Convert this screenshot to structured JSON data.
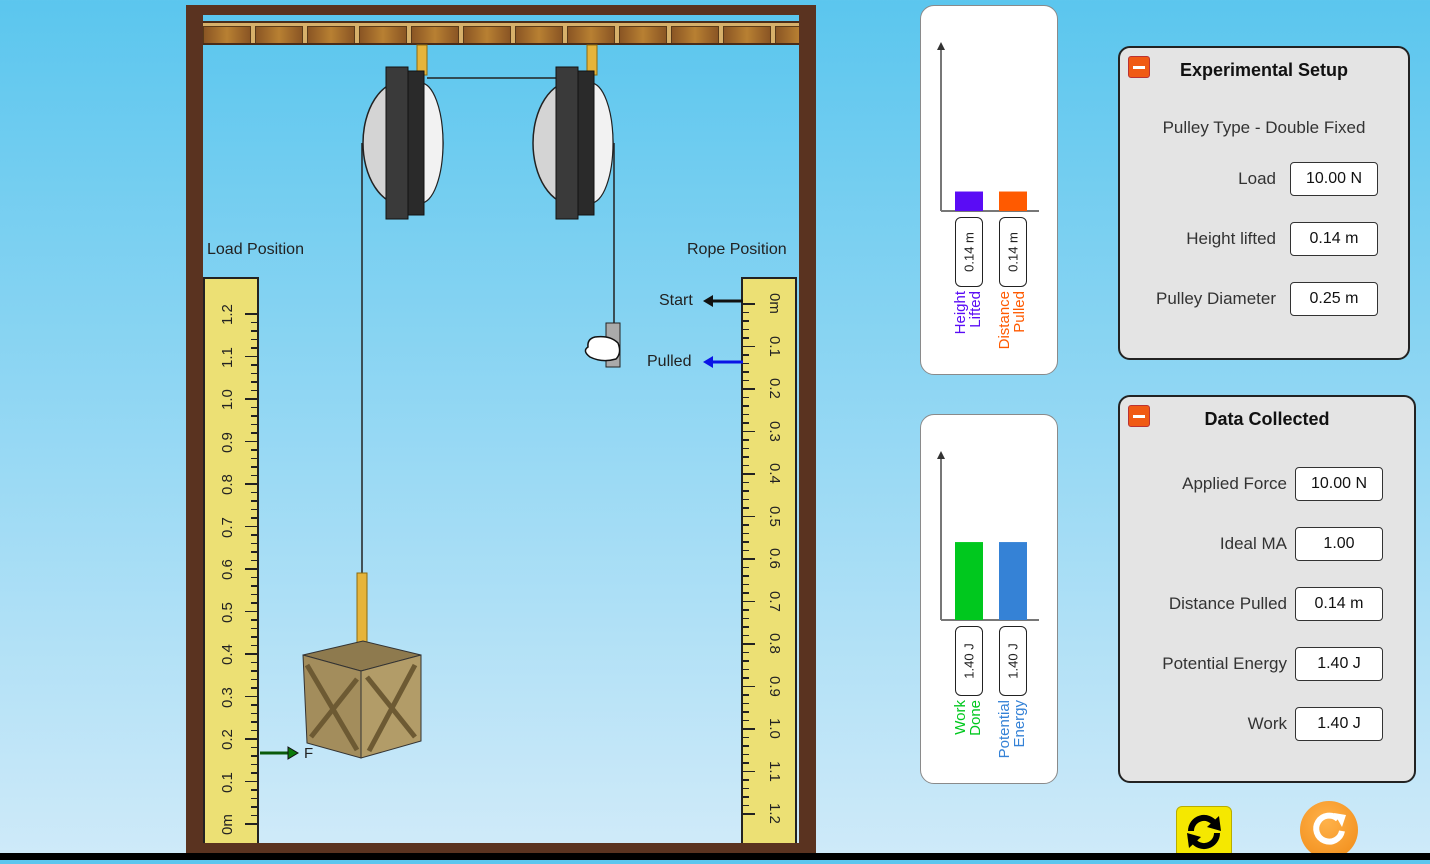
{
  "simulation": {
    "load_ruler": {
      "label": "Load Position",
      "ticks": [
        "0m",
        "0.1",
        "0.2",
        "0.3",
        "0.4",
        "0.5",
        "0.6",
        "0.7",
        "0.8",
        "0.9",
        "1.0",
        "1.1",
        "1.2"
      ],
      "force_marker": "F",
      "force_marker_value_m": 0.14
    },
    "rope_ruler": {
      "label": "Rope Position",
      "ticks": [
        "0m",
        "0.1",
        "0.2",
        "0.3",
        "0.4",
        "0.5",
        "0.6",
        "0.7",
        "0.8",
        "0.9",
        "1.0",
        "1.1",
        "1.2"
      ],
      "start_marker": "Start",
      "start_value_m": 0,
      "pulled_marker": "Pulled",
      "pulled_value_m": 0.14
    }
  },
  "distance_chart": {
    "bars": [
      {
        "name": "Height Lifted",
        "label_lines": "Height\nLifted",
        "value": 0.14,
        "display": "0.14 m",
        "color": "#5a0cf5"
      },
      {
        "name": "Distance Pulled",
        "label_lines": "Distance\nPulled",
        "value": 0.14,
        "display": "0.14 m",
        "color": "#ff5a00"
      }
    ],
    "ymax": 1.2
  },
  "energy_chart": {
    "bars": [
      {
        "name": "Work Done",
        "label_lines": "Work\nDone",
        "value": 1.4,
        "display": "1.40 J",
        "color": "#00c81e"
      },
      {
        "name": "Potential Energy",
        "label_lines": "Potential\nEnergy",
        "value": 1.4,
        "display": "1.40 J",
        "color": "#3582d6"
      }
    ],
    "ymax": 3.0
  },
  "experimental_setup": {
    "title": "Experimental Setup",
    "pulley_type": "Pulley Type - Double Fixed",
    "rows": [
      {
        "label": "Load",
        "value": "10.00 N"
      },
      {
        "label": "Height lifted",
        "value": "0.14 m"
      },
      {
        "label": "Pulley Diameter",
        "value": "0.25 m"
      }
    ]
  },
  "data_collected": {
    "title": "Data Collected",
    "rows": [
      {
        "label": "Applied Force",
        "value": "10.00 N"
      },
      {
        "label": "Ideal MA",
        "value": "1.00"
      },
      {
        "label": "Distance Pulled",
        "value": "0.14 m"
      },
      {
        "label": "Potential Energy",
        "value": "1.40 J"
      },
      {
        "label": "Work",
        "value": "1.40 J"
      }
    ]
  },
  "controls": {
    "reset_icon": "refresh-icon",
    "replay_icon": "replay-icon"
  }
}
